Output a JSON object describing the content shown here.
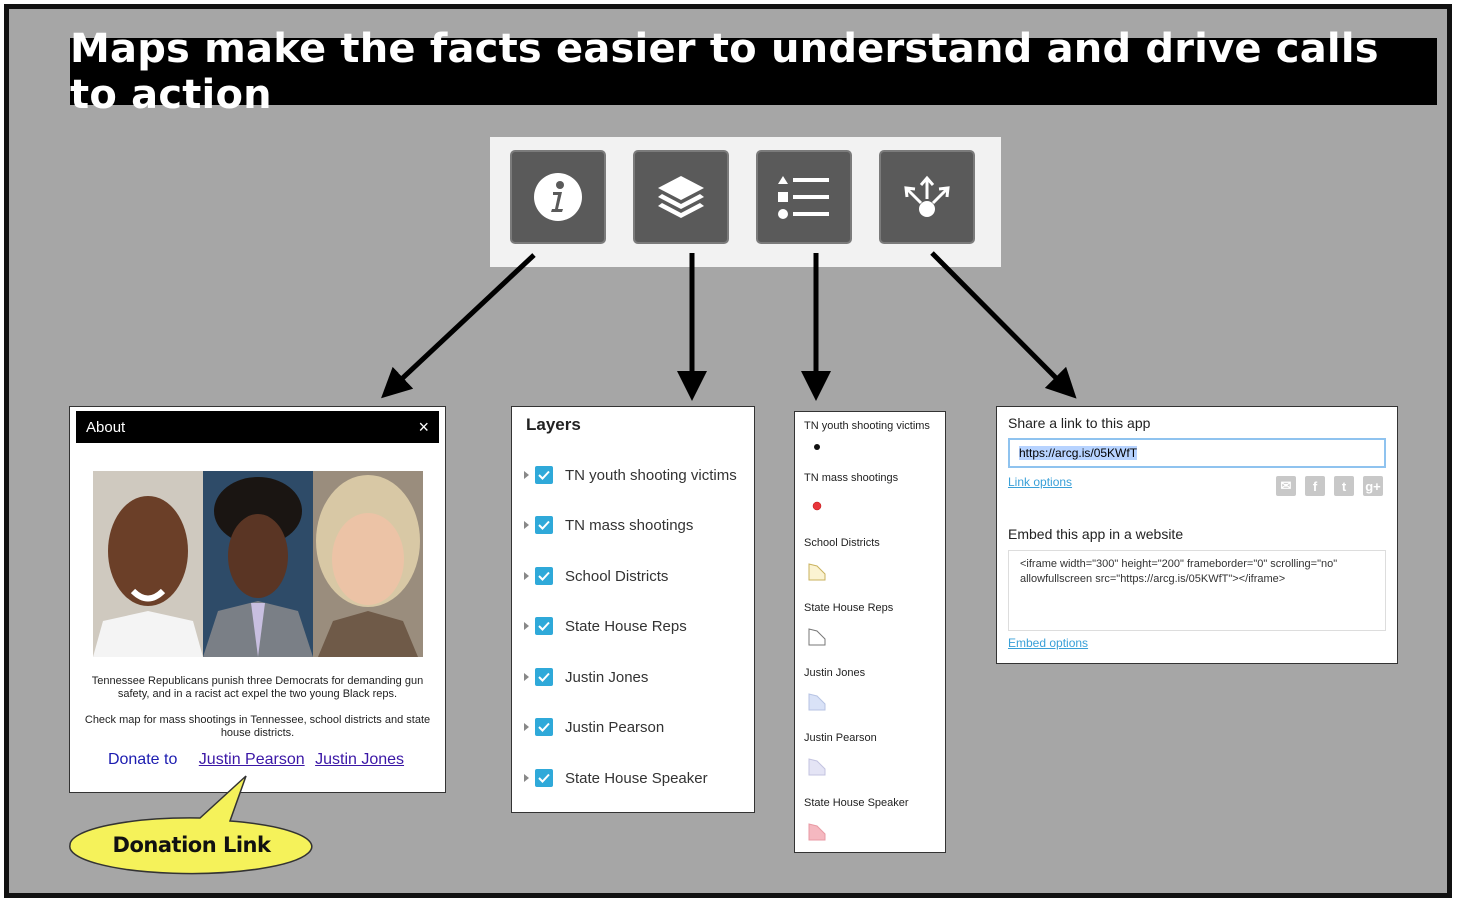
{
  "title": "Maps make the facts easier to understand and drive calls to action",
  "toolbar": {
    "buttons": [
      {
        "icon": "info-icon"
      },
      {
        "icon": "layers-icon"
      },
      {
        "icon": "legend-list-icon"
      },
      {
        "icon": "share-icon"
      }
    ]
  },
  "about": {
    "header": "About",
    "close": "×",
    "text1": "Tennessee Republicans punish three Democrats for demanding gun safety, and in a racist act expel the two young Black reps.",
    "text2": "Check map for mass shootings in Tennessee, school districts and state house districts.",
    "donate_label": "Donate to",
    "links": [
      "Justin Pearson",
      "Justin Jones"
    ]
  },
  "layers": {
    "title": "Layers",
    "items": [
      "TN youth shooting victims",
      "TN mass shootings",
      "School Districts",
      "State House Reps",
      "Justin Jones",
      "Justin Pearson",
      "State House Speaker"
    ]
  },
  "legend": {
    "items": [
      "TN youth shooting victims",
      "TN mass shootings",
      "School Districts",
      "State House Reps",
      "Justin Jones",
      "Justin Pearson",
      "State House Speaker"
    ],
    "colors": {
      "black_dot": "#111111",
      "red_dot": "#e8353b",
      "school": "#f5e6a8",
      "reps": "#ffffff",
      "jones": "#d9e2f7",
      "pearson": "#e4e4f5",
      "speaker": "#f5b8c0"
    }
  },
  "share": {
    "link_heading": "Share a link to this app",
    "url": "https://arcg.is/05KWfT",
    "link_options": "Link options",
    "embed_heading": "Embed this app in a website",
    "embed_code": "<iframe width=\"300\" height=\"200\" frameborder=\"0\" scrolling=\"no\" allowfullscreen src=\"https://arcg.is/05KWfT\"></iframe>",
    "embed_options": "Embed options",
    "social_icons": [
      "email-icon",
      "facebook-icon",
      "twitter-icon",
      "google-plus-icon"
    ]
  },
  "callout": {
    "text": "Donation Link",
    "fill": "#f5f25a"
  }
}
